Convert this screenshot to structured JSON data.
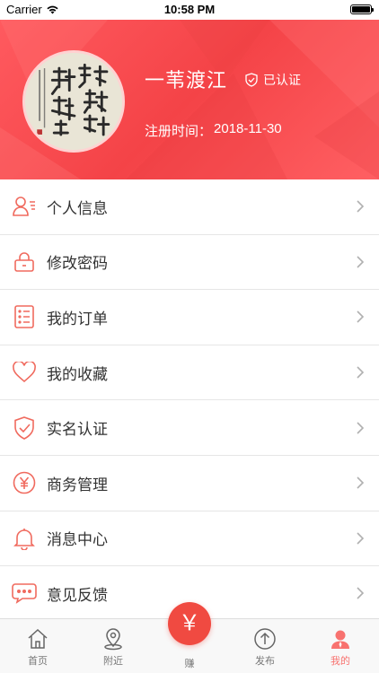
{
  "status_bar": {
    "carrier": "Carrier",
    "time": "10:58 PM"
  },
  "profile": {
    "username": "一苇渡江",
    "verified_label": "已认证",
    "register_label": "注册时间：",
    "register_date": "2018-11-30",
    "avatar_icon": "calligraphy-avatar"
  },
  "menu": [
    {
      "label": "个人信息",
      "icon": "user-info-icon"
    },
    {
      "label": "修改密码",
      "icon": "lock-icon"
    },
    {
      "label": "我的订单",
      "icon": "order-list-icon"
    },
    {
      "label": "我的收藏",
      "icon": "heart-icon"
    },
    {
      "label": "实名认证",
      "icon": "shield-check-icon"
    },
    {
      "label": "商务管理",
      "icon": "yuan-circle-icon"
    },
    {
      "label": "消息中心",
      "icon": "bell-icon"
    },
    {
      "label": "意见反馈",
      "icon": "chat-bubble-icon"
    }
  ],
  "tabbar": {
    "tabs": [
      {
        "label": "首页",
        "icon": "home-icon",
        "active": false
      },
      {
        "label": "附近",
        "icon": "location-icon",
        "active": false
      },
      {
        "label": "赚",
        "icon": "yuan-icon",
        "active": false
      },
      {
        "label": "发布",
        "icon": "upload-icon",
        "active": false
      },
      {
        "label": "我的",
        "icon": "profile-icon",
        "active": true
      }
    ],
    "fab_symbol": "￥"
  },
  "colors": {
    "accent": "#f44347",
    "icon_accent": "#f06a5e",
    "tab_active": "#f8726f"
  }
}
